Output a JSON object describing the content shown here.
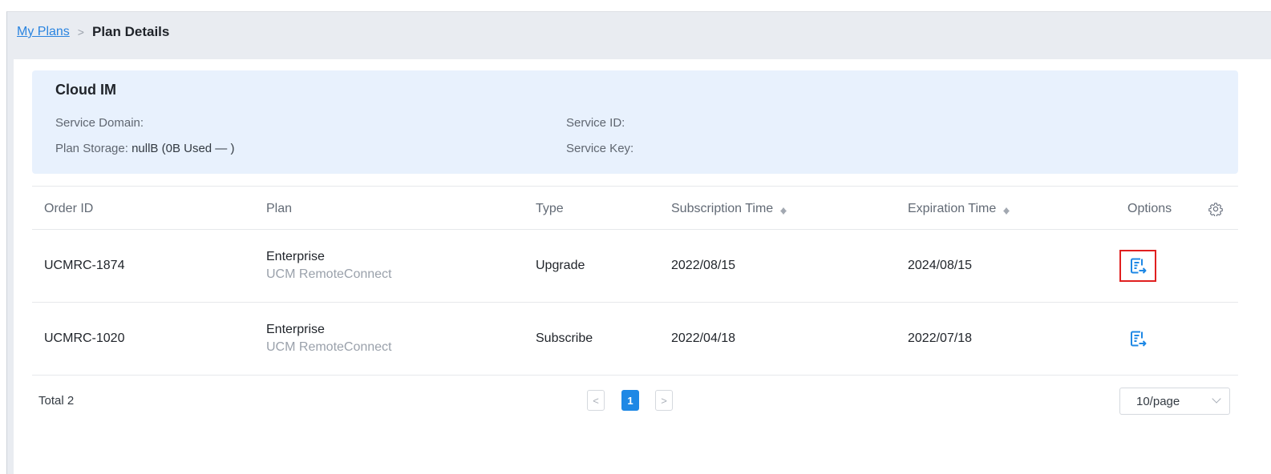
{
  "breadcrumb": {
    "parent": "My Plans",
    "separator": ">",
    "current": "Plan Details"
  },
  "service": {
    "name": "Cloud IM",
    "domain_label": "Service Domain:",
    "domain_value": "",
    "storage_label": "Plan Storage:",
    "storage_value": "nullB (0B Used — )",
    "service_id_label": "Service ID:",
    "service_id_value": "",
    "service_key_label": "Service Key:",
    "service_key_value": ""
  },
  "table": {
    "columns": {
      "order_id": "Order ID",
      "plan": "Plan",
      "type": "Type",
      "subscription_time": "Subscription Time",
      "expiration_time": "Expiration Time",
      "options": "Options"
    },
    "rows": [
      {
        "order_id": "UCMRC-1874",
        "plan_name": "Enterprise",
        "plan_product": "UCM RemoteConnect",
        "type": "Upgrade",
        "subscription_time": "2022/08/15",
        "expiration_time": "2024/08/15",
        "option_icon": "export-detail-icon",
        "highlighted": true
      },
      {
        "order_id": "UCMRC-1020",
        "plan_name": "Enterprise",
        "plan_product": "UCM RemoteConnect",
        "type": "Subscribe",
        "subscription_time": "2022/04/18",
        "expiration_time": "2022/07/18",
        "option_icon": "export-detail-icon",
        "highlighted": false
      }
    ]
  },
  "footer": {
    "total": "Total 2",
    "prev": "<",
    "current_page": "1",
    "next": ">",
    "page_size": "10/page"
  },
  "colors": {
    "accent": "#1e88e5",
    "highlight_border": "#e02020",
    "info_background": "#e8f1fd"
  }
}
